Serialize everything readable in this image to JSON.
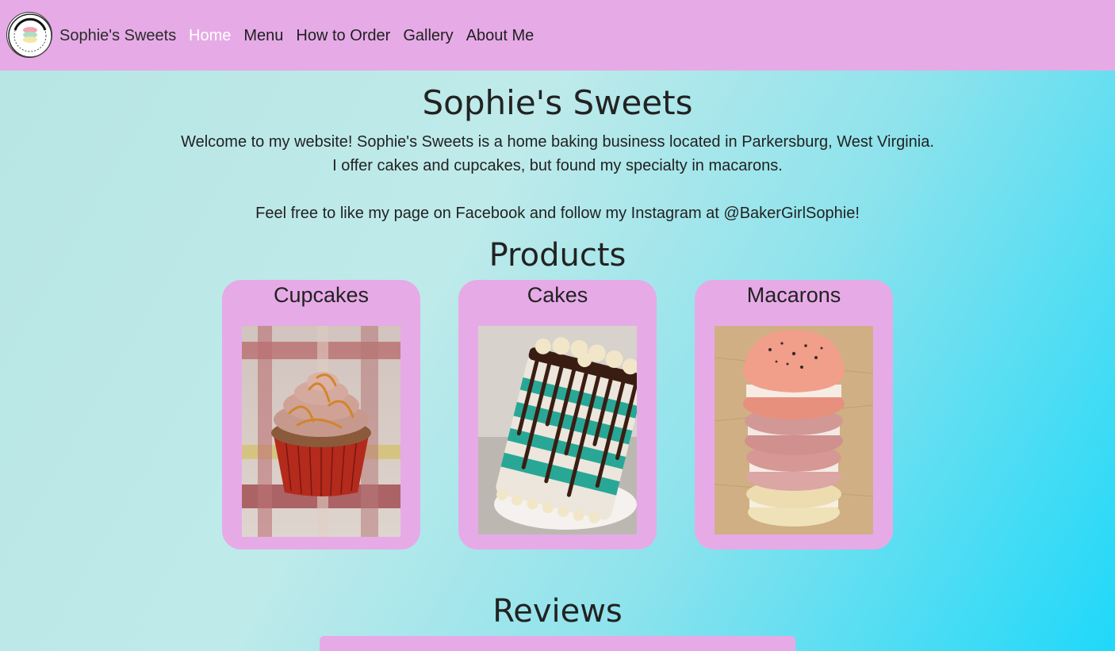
{
  "nav": {
    "brand": "Sophie's Sweets",
    "links": [
      "Home",
      "Menu",
      "How to Order",
      "Gallery",
      "About Me"
    ],
    "active": "Home"
  },
  "hero": {
    "title": "Sophie's Sweets",
    "line1": "Welcome to my website! Sophie's Sweets is a home baking business located in Parkersburg, West Virginia.",
    "line2": "I offer cakes and cupcakes, but found my specialty in macarons.",
    "line3": "Feel free to like my page on Facebook and follow my Instagram at @BakerGirlSophie!"
  },
  "products": {
    "title": "Products",
    "items": [
      {
        "name": "Cupcakes",
        "image": "cupcake-photo"
      },
      {
        "name": "Cakes",
        "image": "cake-photo"
      },
      {
        "name": "Macarons",
        "image": "macaron-photo"
      }
    ]
  },
  "reviews": {
    "title": "Reviews"
  },
  "colors": {
    "nav_bg": "#e6abe6",
    "card_bg": "#e6abe6",
    "active_link": "#ffffff",
    "bg_start": "#b7e6e4",
    "bg_end": "#1fd8f9"
  }
}
